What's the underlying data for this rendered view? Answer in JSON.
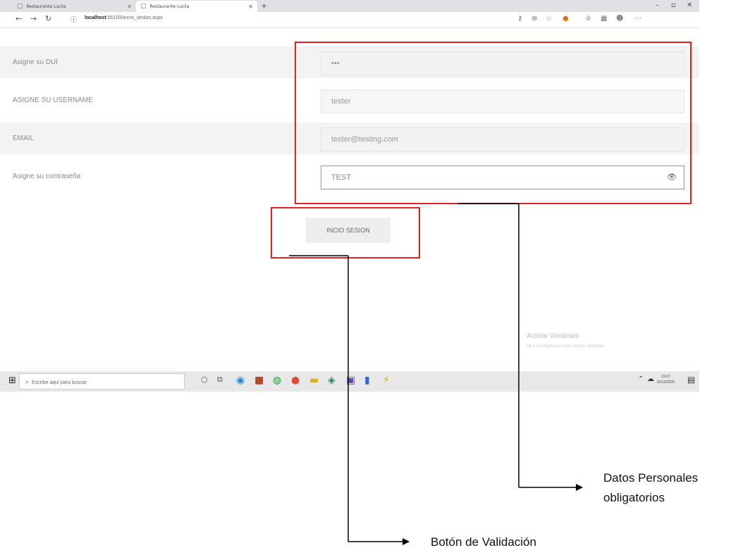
{
  "browser": {
    "tabs": [
      {
        "label": "Restaurante Lucila"
      },
      {
        "label": "Restaurante Lucila"
      }
    ],
    "url_host": "localhost",
    "url_path": ":56100/inicio_sesion.aspx"
  },
  "form": {
    "rows": [
      {
        "label": "Asigne su DUI",
        "value": "•••"
      },
      {
        "label": "ASIGNE SU USERNAME",
        "value": "tester"
      },
      {
        "label": "EMAIL",
        "value": "tester@testing.com"
      },
      {
        "label": "Asigne su contraseña",
        "value": "TEST"
      }
    ],
    "submit_label": "INCIO SESION"
  },
  "watermark": {
    "title": "Activar Windows",
    "subtitle": "Ve a Configuración para activar Windows."
  },
  "taskbar": {
    "search_placeholder": "Escribe aquí para buscar",
    "time": "19:07",
    "date": "22/10/2020"
  },
  "annotations": {
    "personal_data_line1": "Datos Personales",
    "personal_data_line2": "obligatorios",
    "validation_button": "Botón de Validación"
  },
  "colors": {
    "highlight_box": "#e8201f",
    "password_border": "#a98aa3"
  }
}
